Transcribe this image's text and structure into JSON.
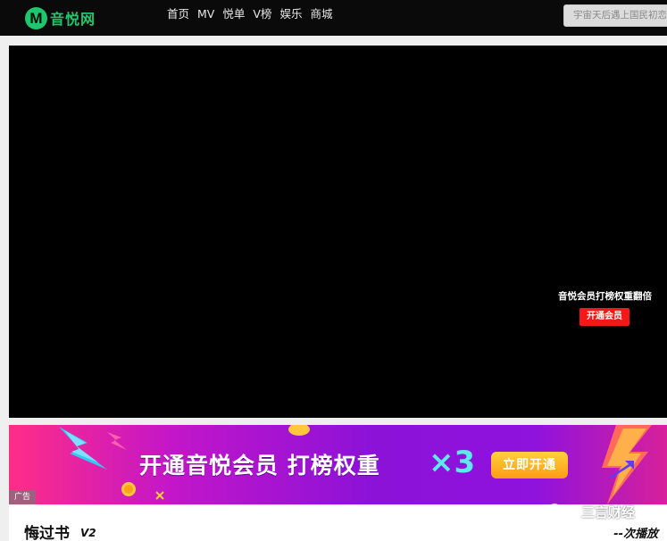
{
  "header": {
    "logo_text": "音悦网",
    "logo_letter": "M",
    "nav": [
      "首页",
      "MV",
      "悦单",
      "V榜",
      "娱乐",
      "商城"
    ],
    "search_placeholder": "宇宙天后遇上国民初恋"
  },
  "player": {
    "promo_text": "音悦会员打榜权重翻倍",
    "promo_button": "开通会员"
  },
  "ad": {
    "label": "广告",
    "headline": "开通音悦会员 打榜权重",
    "multiplier": "×3",
    "cta": "立即开通"
  },
  "bottom": {
    "song_title": "悔过书",
    "badge": "V2",
    "play_count": "--次播放"
  },
  "watermark": {
    "text": "三言财经"
  },
  "colors": {
    "brand_green": "#1fc66b",
    "promo_red": "#f41818",
    "ad_purple": "#8c12d8"
  }
}
